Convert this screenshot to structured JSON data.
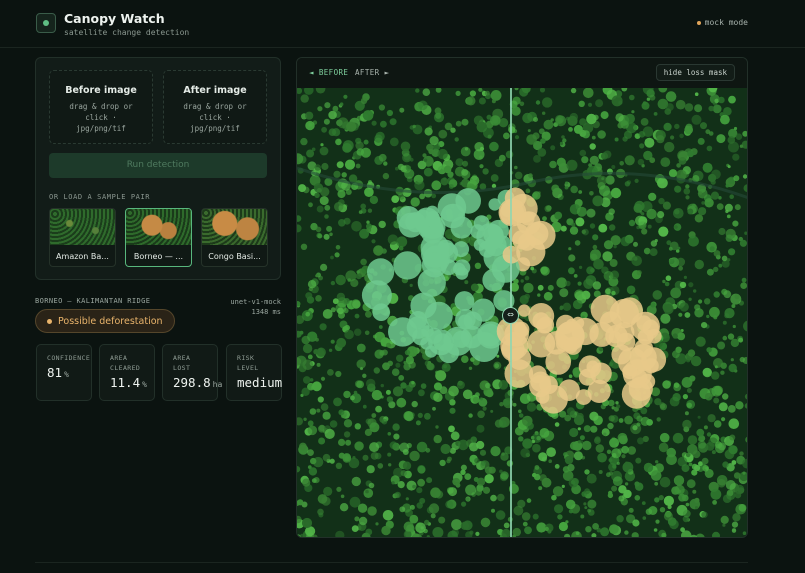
{
  "app": {
    "title": "Canopy Watch",
    "subtitle": "satellite change detection",
    "mode": "mock mode"
  },
  "upload": {
    "before": {
      "title": "Before image",
      "hint": "drag & drop or click · jpg/png/tif"
    },
    "after": {
      "title": "After image",
      "hint": "drag & drop or click · jpg/png/tif"
    },
    "run_label": "Run detection"
  },
  "samples": {
    "heading": "OR LOAD A SAMPLE PAIR",
    "items": [
      {
        "label": "Amazon Ba...",
        "selected": false
      },
      {
        "label": "Borneo — ...",
        "selected": true
      },
      {
        "label": "Congo Basi...",
        "selected": false
      }
    ]
  },
  "result": {
    "location": "BORNEO — KALIMANTAN RIDGE",
    "model": "unet-v1-mock",
    "latency": "1348 ms",
    "verdict": "Possible deforestation",
    "stats": [
      {
        "key": "CONFIDENCE",
        "value": "81",
        "unit": "%"
      },
      {
        "key": "AREA CLEARED",
        "value": "11.4",
        "unit": "%"
      },
      {
        "key": "AREA LOST",
        "value": "298.8",
        "unit": "ha"
      },
      {
        "key": "RISK LEVEL",
        "value": "medium",
        "unit": ""
      }
    ]
  },
  "viewer": {
    "before_label": "◄ BEFORE",
    "after_label": "AFTER ►",
    "mask_toggle": "hide loss mask",
    "split_fraction": 0.475
  },
  "colors": {
    "accent": "#5fbf84",
    "warning": "#e9b46b",
    "background": "#0b1310"
  },
  "icons": {
    "logo": "logo-icon",
    "handle": "split-handle-icon"
  }
}
